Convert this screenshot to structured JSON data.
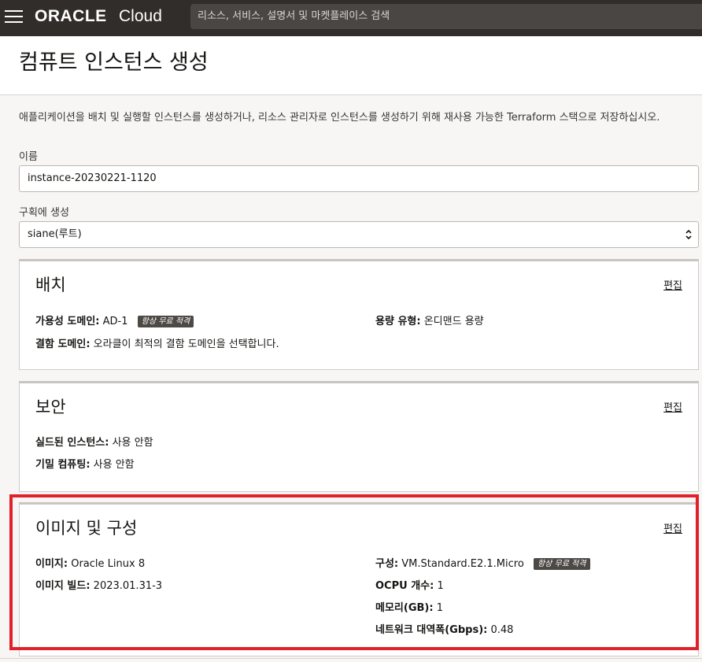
{
  "topbar": {
    "logo_oracle": "ORACLE",
    "logo_cloud": "Cloud",
    "search_placeholder": "리소스, 서비스, 설명서 및 마켓플레이스 검색"
  },
  "page": {
    "title": "컴퓨트 인스턴스 생성",
    "intro": "애플리케이션을 배치 및 실행할 인스턴스를 생성하거나, 리소스 관리자로 인스턴스를 생성하기 위해 재사용 가능한 Terraform 스택으로 저장하십시오."
  },
  "name_field": {
    "label": "이름",
    "value": "instance-20230221-1120"
  },
  "compartment_field": {
    "label": "구획에 생성",
    "value": "siane(루트)"
  },
  "placement": {
    "title": "배치",
    "edit": "편집",
    "ad_label": "가용성 도메인:",
    "ad_value": "AD-1",
    "ad_badge": "항상 무료 적격",
    "capacity_label": "용량 유형:",
    "capacity_value": "온디맨드 용량",
    "fd_label": "결함 도메인:",
    "fd_value": "오라클이 최적의 결함 도메인을 선택합니다."
  },
  "security": {
    "title": "보안",
    "edit": "편집",
    "shielded_label": "실드된 인스턴스:",
    "shielded_value": "사용 안함",
    "confidential_label": "기밀 컴퓨팅:",
    "confidential_value": "사용 안함"
  },
  "image_shape": {
    "title": "이미지 및 구성",
    "edit": "편집",
    "image_label": "이미지:",
    "image_value": "Oracle Linux 8",
    "build_label": "이미지 빌드:",
    "build_value": "2023.01.31-3",
    "shape_label": "구성:",
    "shape_value": "VM.Standard.E2.1.Micro",
    "shape_badge": "항상 무료 적격",
    "ocpu_label": "OCPU 개수:",
    "ocpu_value": "1",
    "memory_label": "메모리(GB):",
    "memory_value": "1",
    "bandwidth_label": "네트워크 대역폭(Gbps):",
    "bandwidth_value": "0.48"
  },
  "colors": {
    "highlight": "#e0202a",
    "topbar": "#312d2a"
  }
}
